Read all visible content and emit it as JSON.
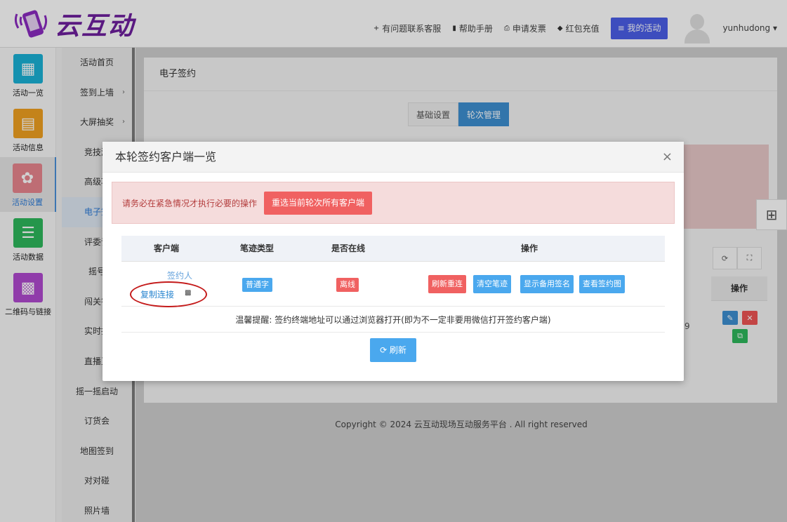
{
  "header": {
    "logo_text": "云互动",
    "nav": [
      {
        "icon": "user-plus-icon",
        "glyph": "+",
        "label": "有问题联系客服"
      },
      {
        "icon": "book-icon",
        "glyph": "▮",
        "label": "帮助手册"
      },
      {
        "icon": "printer-icon",
        "glyph": "⎙",
        "label": "申请发票"
      },
      {
        "icon": "shield-icon",
        "glyph": "◆",
        "label": "红包充值"
      }
    ],
    "my_activity": "≡ 我的活动",
    "username": "yunhudong ▾"
  },
  "icon_sidebar": [
    {
      "label": "活动一览",
      "color": "#1ab1d6",
      "glyph": "▦"
    },
    {
      "label": "活动信息",
      "color": "#f0a020",
      "glyph": "▤"
    },
    {
      "label": "活动设置",
      "color": "#e8858e",
      "glyph": "✿"
    },
    {
      "label": "活动数据",
      "color": "#2eb85c",
      "glyph": "☰"
    },
    {
      "label": "二维码与链接",
      "color": "#b04ad0",
      "glyph": "▩"
    }
  ],
  "sub_menu": [
    {
      "label": "活动首页",
      "arrow": ""
    },
    {
      "label": "签到上墙",
      "arrow": "›"
    },
    {
      "label": "大屏抽奖",
      "arrow": "›"
    },
    {
      "label": "竞技游",
      "arrow": ""
    },
    {
      "label": "高级功",
      "arrow": ""
    },
    {
      "label": "电子签",
      "arrow": ""
    },
    {
      "label": "评委评",
      "arrow": ""
    },
    {
      "label": "摇号",
      "arrow": ""
    },
    {
      "label": "闯关答",
      "arrow": ""
    },
    {
      "label": "实时投",
      "arrow": ""
    },
    {
      "label": "直播互",
      "arrow": ""
    },
    {
      "label": "摇一摇启动",
      "arrow": ""
    },
    {
      "label": "订货会",
      "arrow": ""
    },
    {
      "label": "地图签到",
      "arrow": ""
    },
    {
      "label": "对对碰",
      "arrow": ""
    },
    {
      "label": "照片墙",
      "arrow": ""
    }
  ],
  "panel": {
    "title": "电子签约",
    "tabs": [
      "基础设置",
      "轮次管理"
    ],
    "op_header": "操作",
    "tool_refresh": "⟳",
    "tool_expand": "⛶",
    "footer": "Copyright © 2024 云互动现场互动服务平台 . All right reserved",
    "side_digit": "9"
  },
  "modal": {
    "title": "本轮签约客户端一览",
    "close": "×",
    "warning_text": "请务必在紧急情况才执行必要的操作",
    "warning_button": "重选当前轮次所有客户端",
    "columns": [
      "客户端",
      "笔迹类型",
      "是否在线",
      "操作"
    ],
    "row": {
      "signer": "签约人",
      "copy_link": "复制连接",
      "qr_glyph": "▩",
      "stroke_type": "普通字",
      "online_status": "离线",
      "actions": [
        "刷新重连",
        "清空笔迹",
        "显示备用签名",
        "查看签约图"
      ]
    },
    "tip": "温馨提醒: 签约终端地址可以通过浏览器打开(即为不一定非要用微信打开签约客户端)",
    "refresh_button": "⟳ 刷新"
  }
}
